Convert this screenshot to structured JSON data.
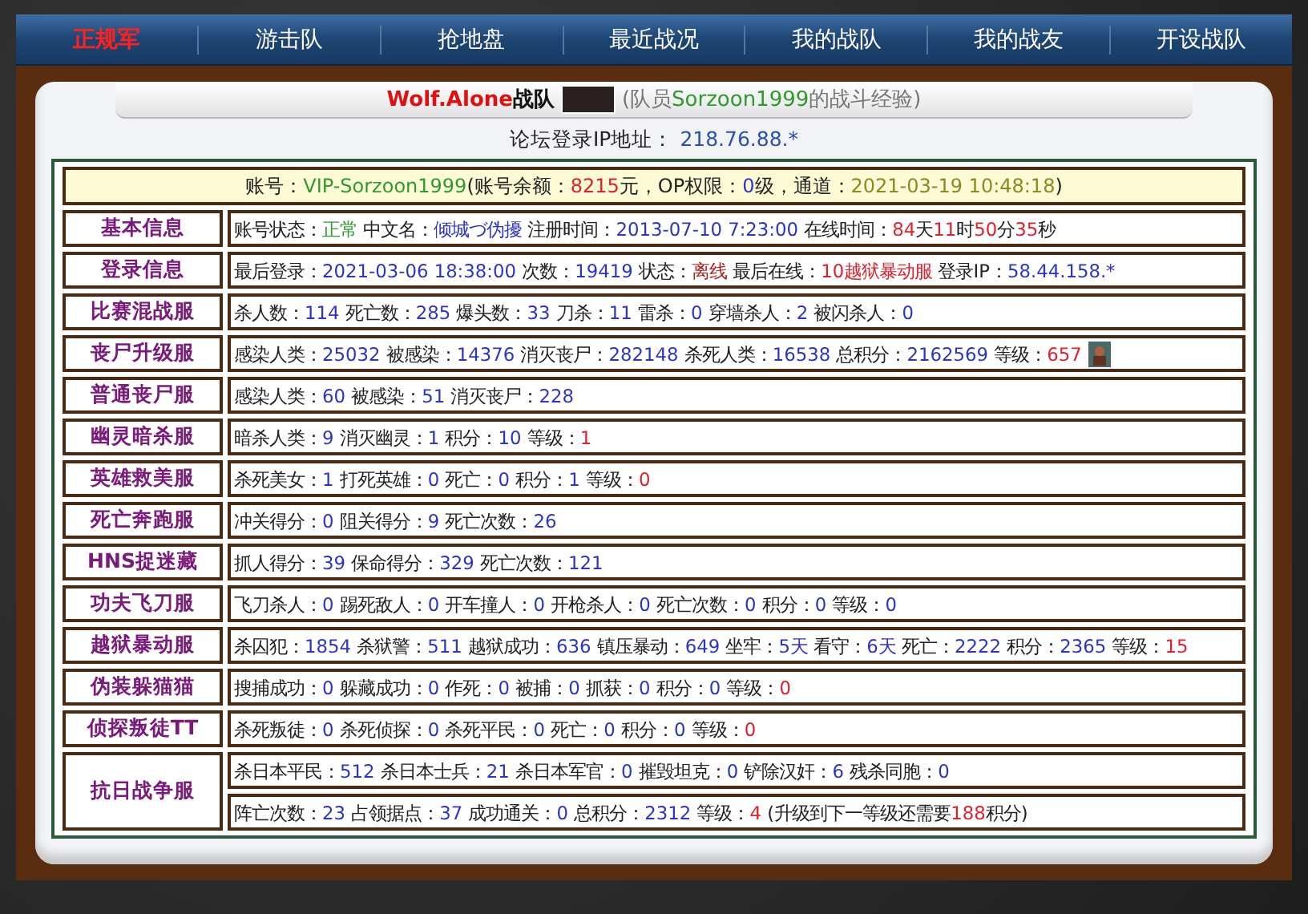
{
  "nav": [
    {
      "label": "正规军",
      "selected": true
    },
    {
      "label": "游击队",
      "selected": false
    },
    {
      "label": "抢地盘",
      "selected": false
    },
    {
      "label": "最近战况",
      "selected": false
    },
    {
      "label": "我的战队",
      "selected": false
    },
    {
      "label": "我的战友",
      "selected": false
    },
    {
      "label": "开设战队",
      "selected": false
    }
  ],
  "header": {
    "team_name": "Wolf.Alone",
    "team_suffix": "战队",
    "member_note": [
      {
        "text": "(队员",
        "kind": "note"
      },
      {
        "text": "Sorzoon1999",
        "kind": "name"
      },
      {
        "text": "的战斗经验)",
        "kind": "note"
      }
    ]
  },
  "forum_ip": {
    "label": "论坛登录IP地址：",
    "value": "218.76.88.*"
  },
  "account_line": [
    {
      "text": "账号：",
      "kind": "label"
    },
    {
      "text": "VIP-Sorzoon1999",
      "kind": "name"
    },
    {
      "text": "(账号余额：",
      "kind": "label"
    },
    {
      "text": "8215",
      "kind": "highlight"
    },
    {
      "text": "元，OP权限：",
      "kind": "label"
    },
    {
      "text": "0",
      "kind": "value"
    },
    {
      "text": "级，通道：",
      "kind": "label"
    },
    {
      "text": "2021-03-19 10:48:18",
      "kind": "date"
    },
    {
      "text": ")",
      "kind": "label"
    }
  ],
  "rows": [
    {
      "label": "基本信息",
      "lines": [
        [
          {
            "text": "账号状态：",
            "kind": "label"
          },
          {
            "text": "正常",
            "kind": "name"
          },
          {
            "text": " 中文名：",
            "kind": "label"
          },
          {
            "text": "倾城づ伪擾",
            "kind": "value"
          },
          {
            "text": " 注册时间：",
            "kind": "label"
          },
          {
            "text": "2013-07-10 7:23:00",
            "kind": "value"
          },
          {
            "text": " 在线时间：",
            "kind": "label"
          },
          {
            "text": "84",
            "kind": "highlight"
          },
          {
            "text": "天",
            "kind": "label"
          },
          {
            "text": "11",
            "kind": "highlight"
          },
          {
            "text": "时",
            "kind": "label"
          },
          {
            "text": "50",
            "kind": "highlight"
          },
          {
            "text": "分",
            "kind": "label"
          },
          {
            "text": "35",
            "kind": "highlight"
          },
          {
            "text": "秒",
            "kind": "label"
          }
        ]
      ]
    },
    {
      "label": "登录信息",
      "lines": [
        [
          {
            "text": "最后登录：",
            "kind": "label"
          },
          {
            "text": "2021-03-06 18:38:00",
            "kind": "value"
          },
          {
            "text": " 次数：",
            "kind": "label"
          },
          {
            "text": "19419",
            "kind": "value"
          },
          {
            "text": " 状态：",
            "kind": "label"
          },
          {
            "text": "离线",
            "kind": "offline"
          },
          {
            "text": " 最后在线：",
            "kind": "label"
          },
          {
            "text": "10越狱暴动服",
            "kind": "highlight"
          },
          {
            "text": " 登录IP：",
            "kind": "label"
          },
          {
            "text": "58.44.158.*",
            "kind": "value"
          }
        ]
      ]
    },
    {
      "label": "比赛混战服",
      "lines": [
        [
          {
            "text": "杀人数：",
            "kind": "label"
          },
          {
            "text": "114",
            "kind": "value"
          },
          {
            "text": " 死亡数：",
            "kind": "label"
          },
          {
            "text": "285",
            "kind": "value"
          },
          {
            "text": " 爆头数：",
            "kind": "label"
          },
          {
            "text": "33",
            "kind": "value"
          },
          {
            "text": " 刀杀：",
            "kind": "label"
          },
          {
            "text": "11",
            "kind": "value"
          },
          {
            "text": " 雷杀：",
            "kind": "label"
          },
          {
            "text": "0",
            "kind": "value"
          },
          {
            "text": " 穿墙杀人：",
            "kind": "label"
          },
          {
            "text": "2",
            "kind": "value"
          },
          {
            "text": " 被闪杀人：",
            "kind": "label"
          },
          {
            "text": "0",
            "kind": "value"
          }
        ]
      ]
    },
    {
      "label": "丧尸升级服",
      "badge": true,
      "lines": [
        [
          {
            "text": "感染人类：",
            "kind": "label"
          },
          {
            "text": "25032",
            "kind": "value"
          },
          {
            "text": " 被感染：",
            "kind": "label"
          },
          {
            "text": "14376",
            "kind": "value"
          },
          {
            "text": " 消灭丧尸：",
            "kind": "label"
          },
          {
            "text": "282148",
            "kind": "value"
          },
          {
            "text": " 杀死人类：",
            "kind": "label"
          },
          {
            "text": "16538",
            "kind": "value"
          },
          {
            "text": " 总积分：",
            "kind": "label"
          },
          {
            "text": "2162569",
            "kind": "value"
          },
          {
            "text": " 等级：",
            "kind": "label"
          },
          {
            "text": "657",
            "kind": "highlight"
          }
        ]
      ]
    },
    {
      "label": "普通丧尸服",
      "lines": [
        [
          {
            "text": "感染人类：",
            "kind": "label"
          },
          {
            "text": "60",
            "kind": "value"
          },
          {
            "text": " 被感染：",
            "kind": "label"
          },
          {
            "text": "51",
            "kind": "value"
          },
          {
            "text": " 消灭丧尸：",
            "kind": "label"
          },
          {
            "text": "228",
            "kind": "value"
          }
        ]
      ]
    },
    {
      "label": "幽灵暗杀服",
      "lines": [
        [
          {
            "text": "暗杀人类：",
            "kind": "label"
          },
          {
            "text": "9",
            "kind": "value"
          },
          {
            "text": " 消灭幽灵：",
            "kind": "label"
          },
          {
            "text": "1",
            "kind": "value"
          },
          {
            "text": " 积分：",
            "kind": "label"
          },
          {
            "text": "10",
            "kind": "value"
          },
          {
            "text": " 等级：",
            "kind": "label"
          },
          {
            "text": "1",
            "kind": "highlight"
          }
        ]
      ]
    },
    {
      "label": "英雄救美服",
      "lines": [
        [
          {
            "text": "杀死美女：",
            "kind": "label"
          },
          {
            "text": "1",
            "kind": "value"
          },
          {
            "text": " 打死英雄：",
            "kind": "label"
          },
          {
            "text": "0",
            "kind": "value"
          },
          {
            "text": " 死亡：",
            "kind": "label"
          },
          {
            "text": "0",
            "kind": "value"
          },
          {
            "text": " 积分：",
            "kind": "label"
          },
          {
            "text": "1",
            "kind": "value"
          },
          {
            "text": " 等级：",
            "kind": "label"
          },
          {
            "text": "0",
            "kind": "highlight"
          }
        ]
      ]
    },
    {
      "label": "死亡奔跑服",
      "lines": [
        [
          {
            "text": "冲关得分：",
            "kind": "label"
          },
          {
            "text": "0",
            "kind": "value"
          },
          {
            "text": " 阻关得分：",
            "kind": "label"
          },
          {
            "text": "9",
            "kind": "value"
          },
          {
            "text": " 死亡次数：",
            "kind": "label"
          },
          {
            "text": "26",
            "kind": "value"
          }
        ]
      ]
    },
    {
      "label": "HNS捉迷藏",
      "lines": [
        [
          {
            "text": "抓人得分：",
            "kind": "label"
          },
          {
            "text": "39",
            "kind": "value"
          },
          {
            "text": " 保命得分：",
            "kind": "label"
          },
          {
            "text": "329",
            "kind": "value"
          },
          {
            "text": " 死亡次数：",
            "kind": "label"
          },
          {
            "text": "121",
            "kind": "value"
          }
        ]
      ]
    },
    {
      "label": "功夫飞刀服",
      "lines": [
        [
          {
            "text": "飞刀杀人：",
            "kind": "label"
          },
          {
            "text": "0",
            "kind": "value"
          },
          {
            "text": " 踢死敌人：",
            "kind": "label"
          },
          {
            "text": "0",
            "kind": "value"
          },
          {
            "text": " 开车撞人：",
            "kind": "label"
          },
          {
            "text": "0",
            "kind": "value"
          },
          {
            "text": " 开枪杀人：",
            "kind": "label"
          },
          {
            "text": "0",
            "kind": "value"
          },
          {
            "text": " 死亡次数：",
            "kind": "label"
          },
          {
            "text": "0",
            "kind": "value"
          },
          {
            "text": " 积分：",
            "kind": "label"
          },
          {
            "text": "0",
            "kind": "value"
          },
          {
            "text": " 等级：",
            "kind": "label"
          },
          {
            "text": "0",
            "kind": "value"
          }
        ]
      ]
    },
    {
      "label": "越狱暴动服",
      "lines": [
        [
          {
            "text": "杀囚犯：",
            "kind": "label"
          },
          {
            "text": "1854",
            "kind": "value"
          },
          {
            "text": " 杀狱警：",
            "kind": "label"
          },
          {
            "text": "511",
            "kind": "value"
          },
          {
            "text": " 越狱成功：",
            "kind": "label"
          },
          {
            "text": "636",
            "kind": "value"
          },
          {
            "text": " 镇压暴动：",
            "kind": "label"
          },
          {
            "text": "649",
            "kind": "value"
          },
          {
            "text": " 坐牢：",
            "kind": "label"
          },
          {
            "text": "5天",
            "kind": "value"
          },
          {
            "text": " 看守：",
            "kind": "label"
          },
          {
            "text": "6天",
            "kind": "value"
          },
          {
            "text": " 死亡：",
            "kind": "label"
          },
          {
            "text": "2222",
            "kind": "value"
          },
          {
            "text": " 积分：",
            "kind": "label"
          },
          {
            "text": "2365",
            "kind": "value"
          },
          {
            "text": " 等级：",
            "kind": "label"
          },
          {
            "text": "15",
            "kind": "highlight"
          }
        ]
      ]
    },
    {
      "label": "伪装躲猫猫",
      "lines": [
        [
          {
            "text": "搜捕成功：",
            "kind": "label"
          },
          {
            "text": "0",
            "kind": "value"
          },
          {
            "text": " 躲藏成功：",
            "kind": "label"
          },
          {
            "text": "0",
            "kind": "value"
          },
          {
            "text": " 作死：",
            "kind": "label"
          },
          {
            "text": "0",
            "kind": "value"
          },
          {
            "text": " 被捕：",
            "kind": "label"
          },
          {
            "text": "0",
            "kind": "value"
          },
          {
            "text": " 抓获：",
            "kind": "label"
          },
          {
            "text": "0",
            "kind": "value"
          },
          {
            "text": " 积分：",
            "kind": "label"
          },
          {
            "text": "0",
            "kind": "value"
          },
          {
            "text": " 等级：",
            "kind": "label"
          },
          {
            "text": "0",
            "kind": "highlight"
          }
        ]
      ]
    },
    {
      "label": "侦探叛徒TT",
      "lines": [
        [
          {
            "text": "杀死叛徒：",
            "kind": "label"
          },
          {
            "text": "0",
            "kind": "value"
          },
          {
            "text": " 杀死侦探：",
            "kind": "label"
          },
          {
            "text": "0",
            "kind": "value"
          },
          {
            "text": " 杀死平民：",
            "kind": "label"
          },
          {
            "text": "0",
            "kind": "value"
          },
          {
            "text": " 死亡：",
            "kind": "label"
          },
          {
            "text": "0",
            "kind": "value"
          },
          {
            "text": " 积分：",
            "kind": "label"
          },
          {
            "text": "0",
            "kind": "value"
          },
          {
            "text": " 等级：",
            "kind": "label"
          },
          {
            "text": "0",
            "kind": "highlight"
          }
        ]
      ]
    },
    {
      "label": "抗日战争服",
      "lines": [
        [
          {
            "text": "杀日本平民：",
            "kind": "label"
          },
          {
            "text": "512",
            "kind": "value"
          },
          {
            "text": " 杀日本士兵：",
            "kind": "label"
          },
          {
            "text": "21",
            "kind": "value"
          },
          {
            "text": " 杀日本军官：",
            "kind": "label"
          },
          {
            "text": "0",
            "kind": "value"
          },
          {
            "text": " 摧毁坦克：",
            "kind": "label"
          },
          {
            "text": "0",
            "kind": "value"
          },
          {
            "text": " 铲除汉奸：",
            "kind": "label"
          },
          {
            "text": "6",
            "kind": "value"
          },
          {
            "text": " 残杀同胞：",
            "kind": "label"
          },
          {
            "text": "0",
            "kind": "value"
          }
        ],
        [
          {
            "text": "阵亡次数：",
            "kind": "label"
          },
          {
            "text": "23",
            "kind": "value"
          },
          {
            "text": " 占领据点：",
            "kind": "label"
          },
          {
            "text": "37",
            "kind": "value"
          },
          {
            "text": " 成功通关：",
            "kind": "label"
          },
          {
            "text": "0",
            "kind": "value"
          },
          {
            "text": " 总积分：",
            "kind": "label"
          },
          {
            "text": "2312",
            "kind": "value"
          },
          {
            "text": " 等级：",
            "kind": "label"
          },
          {
            "text": "4",
            "kind": "highlight"
          },
          {
            "text": " (升级到下一等级还需要",
            "kind": "label"
          },
          {
            "text": "188",
            "kind": "highlight"
          },
          {
            "text": "积分)",
            "kind": "label"
          }
        ]
      ]
    }
  ]
}
